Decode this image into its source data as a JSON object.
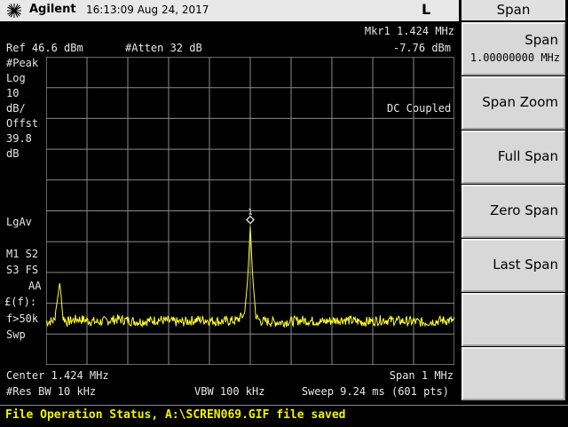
{
  "header": {
    "brand": "Agilent",
    "time": "16:13:09  Aug 24, 2017",
    "mode": "L"
  },
  "annotations": {
    "marker_label": "Mkr1  1.424 MHz",
    "ref_level": "Ref 46.6 dBm",
    "atten": "#Atten 32 dB",
    "marker_value": "-7.76 dBm",
    "detector": "#Peak",
    "scale": [
      "Log",
      "10",
      "dB/"
    ],
    "offset": [
      "Offst",
      "39.8",
      "dB"
    ],
    "coupling": "DC Coupled",
    "averaging": "LgAv",
    "traces": [
      "M1  S2",
      "S3  FS",
      "AA"
    ],
    "freq_corr": "£(f):",
    "freq_range": "f>50k",
    "sweep_mode": "Swp",
    "center": "Center 1.424 MHz",
    "span": "Span 1 MHz",
    "rbw": "#Res BW 10 kHz",
    "vbw": "VBW 100 kHz",
    "sweep": "Sweep 9.24 ms (601 pts)",
    "marker_number": "1"
  },
  "status_bar": {
    "text": "File Operation Status, A:\\SCREN069.GIF file saved"
  },
  "menu": {
    "title": "Span",
    "keys": [
      {
        "label": "Span",
        "value": "1.00000000 MHz"
      },
      {
        "label": "Span Zoom"
      },
      {
        "label": "Full Span"
      },
      {
        "label": "Zero Span"
      },
      {
        "label": "Last Span"
      },
      {
        "label": ""
      },
      {
        "label": ""
      }
    ]
  },
  "colors": {
    "trace": "#ffff33",
    "status_text": "#f2f200",
    "grid": "#8a8a8a"
  },
  "chart_data": {
    "type": "line",
    "x_range_mhz": [
      0.924,
      1.924
    ],
    "center_mhz": 1.424,
    "span_mhz": 1.0,
    "ref_level_dbm": 46.6,
    "db_per_div": 10,
    "y_range_dbm": [
      -53.4,
      46.6
    ],
    "points": 601,
    "marker": {
      "number": 1,
      "x_mhz": 1.424,
      "y_dbm": -7.76
    },
    "trace_x_mhz": [
      0.924,
      0.944,
      0.954,
      0.957,
      0.96,
      0.965,
      0.975,
      1.0,
      1.05,
      1.1,
      1.15,
      1.2,
      1.25,
      1.3,
      1.35,
      1.39,
      1.41,
      1.418,
      1.424,
      1.43,
      1.438,
      1.45,
      1.5,
      1.55,
      1.6,
      1.65,
      1.7,
      1.75,
      1.8,
      1.85,
      1.9,
      1.924
    ],
    "trace_y_dbm": [
      -39.5,
      -39,
      -30,
      -26.5,
      -30,
      -38,
      -39.5,
      -38.5,
      -39.5,
      -38.6,
      -39.4,
      -38.8,
      -39.6,
      -38.7,
      -39.3,
      -39,
      -37,
      -25,
      -8.5,
      -25,
      -38,
      -39.2,
      -39.6,
      -38.9,
      -39.4,
      -38.7,
      -39.5,
      -38.8,
      -39.2,
      -39.6,
      -38.9,
      -39.2
    ]
  }
}
